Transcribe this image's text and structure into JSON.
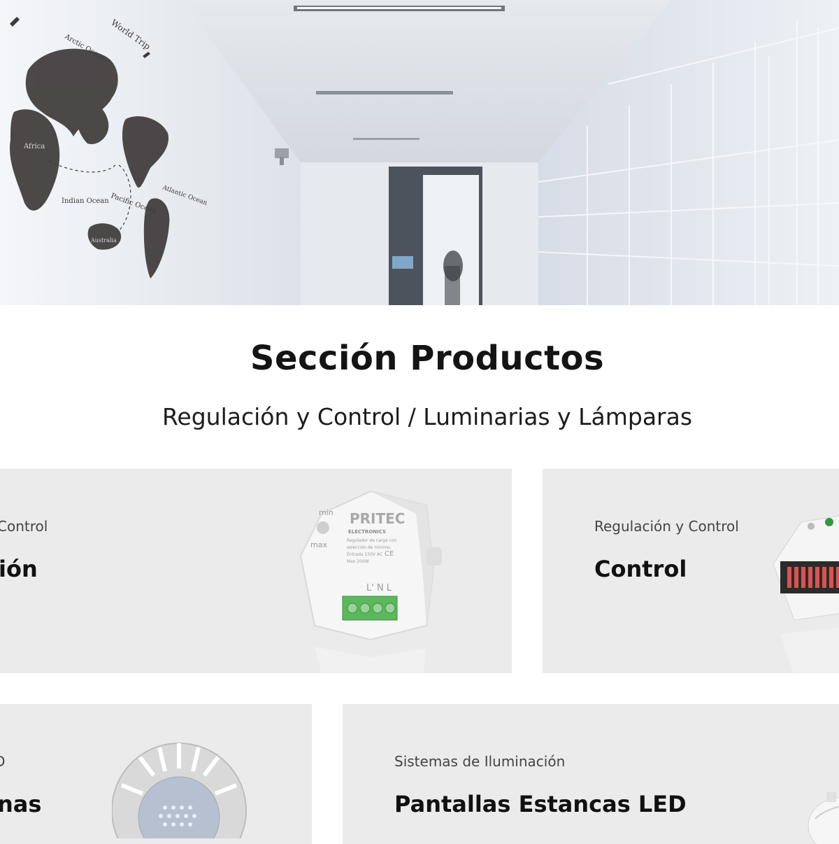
{
  "hero": {
    "map_labels": {
      "world_trip": "World Trip",
      "arctic_ocean": "Arctic Ocean",
      "africa": "Africa",
      "indian_ocean": "Indian Ocean",
      "pacific_ocean": "Pacific Ocean",
      "atlantic": "Atlantic Ocean",
      "australia": "Australia"
    }
  },
  "section": {
    "title": "Sección Productos",
    "subtitle": "Regulación y Control / Luminarias y Lámparas"
  },
  "cards": [
    {
      "category": "Control",
      "name": "ión"
    },
    {
      "category": "Regulación y Control",
      "name": "Control"
    },
    {
      "category": "D",
      "name": "nas"
    },
    {
      "category": "Sistemas de Iluminación",
      "name": "Pantallas Estancas LED"
    }
  ],
  "product_labels": {
    "brand": "PRITEC",
    "brand_sub": "ELECTRONICS",
    "min": "min",
    "max": "max",
    "terminals": "L' N L",
    "spec1": "Regulador de carga con",
    "spec2": "selección de mínimo.",
    "spec3": "Entrada 230V AC",
    "spec4": "Max 200W",
    "ce": "CE"
  }
}
